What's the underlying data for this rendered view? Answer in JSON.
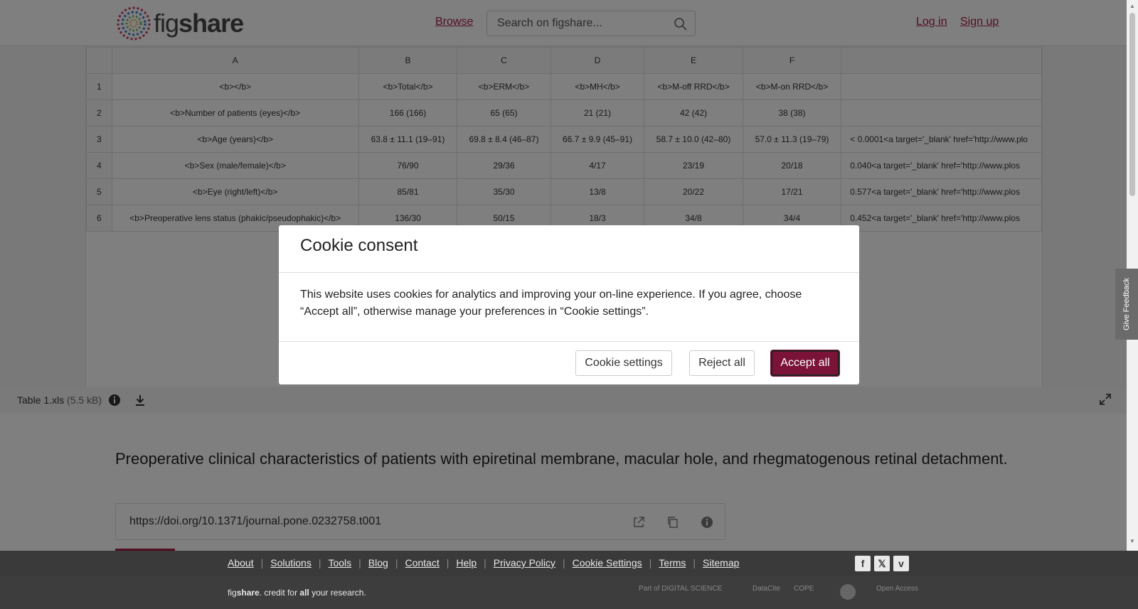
{
  "header": {
    "logo_text_regular": "fig",
    "logo_text_bold": "share",
    "browse_label": "Browse",
    "search_placeholder": "Search on figshare...",
    "login_label": "Log in",
    "signup_label": "Sign up"
  },
  "sheet": {
    "columns": [
      "",
      "A",
      "B",
      "C",
      "D",
      "E",
      "F",
      ""
    ],
    "rows": [
      {
        "num": "1",
        "cells": [
          "<b></b>",
          "<b>Total</b>",
          "<b>ERM</b>",
          "<b>MH</b>",
          "<b>M-off RRD</b>",
          "<b>M-on RRD</b>",
          ""
        ]
      },
      {
        "num": "2",
        "cells": [
          "<b>Number of patients (eyes)</b>",
          "166 (166)",
          "65 (65)",
          "21 (21)",
          "42 (42)",
          "38 (38)",
          ""
        ]
      },
      {
        "num": "3",
        "cells": [
          "<b>Age (years)</b>",
          "63.8 ± 11.1 (19–91)",
          "69.8 ± 8.4 (46–87)",
          "66.7 ± 9.9 (45–91)",
          "58.7 ± 10.0 (42–80)",
          "57.0 ± 11.3 (19–79)",
          "< 0.0001<a target='_blank' href='http://www.plo"
        ]
      },
      {
        "num": "4",
        "cells": [
          "<b>Sex (male/female)</b>",
          "76/90",
          "29/36",
          "4/17",
          "23/19",
          "20/18",
          "0.040<a target='_blank' href='http://www.plos"
        ]
      },
      {
        "num": "5",
        "cells": [
          "<b>Eye (right/left)</b>",
          "85/81",
          "35/30",
          "13/8",
          "20/22",
          "17/21",
          "0.577<a target='_blank' href='http://www.plos"
        ]
      },
      {
        "num": "6",
        "cells": [
          "<b>Preoperative lens status (phakic/pseudophakic)</b>",
          "136/30",
          "50/15",
          "18/3",
          "34/8",
          "34/4",
          "0.452<a target='_blank' href='http://www.plos"
        ]
      }
    ]
  },
  "file": {
    "name": "Table 1.xls",
    "size": "(5.5 kB)"
  },
  "feedback_label": "Give Feedback",
  "article": {
    "title": "Preoperative clinical characteristics of patients with epiretinal membrane, macular hole, and rhegmatogenous retinal detachment.",
    "doi": "https://doi.org/10.1371/journal.pone.0232758.t001"
  },
  "cookie": {
    "title": "Cookie consent",
    "body": "This website uses cookies for analytics and improving your on-line experience. If you agree, choose “Accept all”, otherwise manage your preferences in “Cookie settings”.",
    "settings_label": "Cookie settings",
    "reject_label": "Reject all",
    "accept_label": "Accept all"
  },
  "footer": {
    "links": [
      "About",
      "Solutions",
      "Tools",
      "Blog",
      "Contact",
      "Help",
      "Privacy Policy",
      "Cookie Settings",
      "Terms",
      "Sitemap"
    ],
    "credit_fig": "fig",
    "credit_share": "share",
    "credit_mid": ". credit for ",
    "credit_all": "all",
    "credit_end": " your research.",
    "partners": [
      "Part of DIGITAL SCIENCE",
      "DataCite",
      "COPE",
      "",
      "Open Access"
    ]
  },
  "colors": {
    "brand": "#a51e45",
    "accept_button": "#7a1337",
    "footer_bg": "#3a3a3a"
  }
}
